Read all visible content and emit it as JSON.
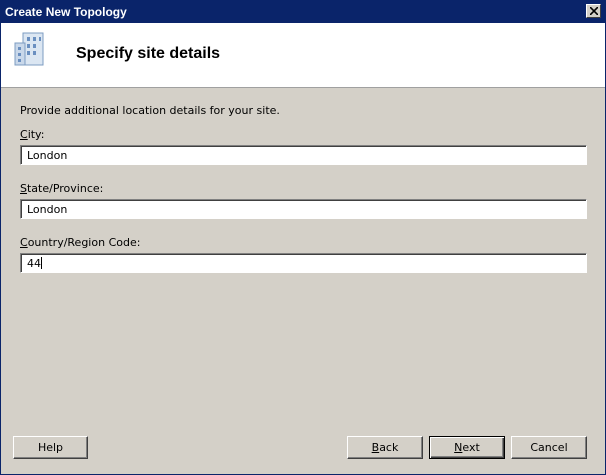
{
  "window": {
    "title": "Create New Topology"
  },
  "header": {
    "title": "Specify site details",
    "icon": "building-icon"
  },
  "form": {
    "description": "Provide additional location details for your site.",
    "city": {
      "label_prefix": "",
      "label_accel": "C",
      "label_rest": "ity:",
      "value": "London"
    },
    "state": {
      "label_prefix": "",
      "label_accel": "S",
      "label_rest": "tate/Province:",
      "value": "London"
    },
    "country": {
      "label_prefix": "",
      "label_accel": "C",
      "label_rest": "ountry/Region Code:",
      "value": "44"
    }
  },
  "buttons": {
    "help": "Help",
    "back_accel": "B",
    "back_rest": "ack",
    "next_accel": "N",
    "next_rest": "ext",
    "cancel": "Cancel"
  }
}
